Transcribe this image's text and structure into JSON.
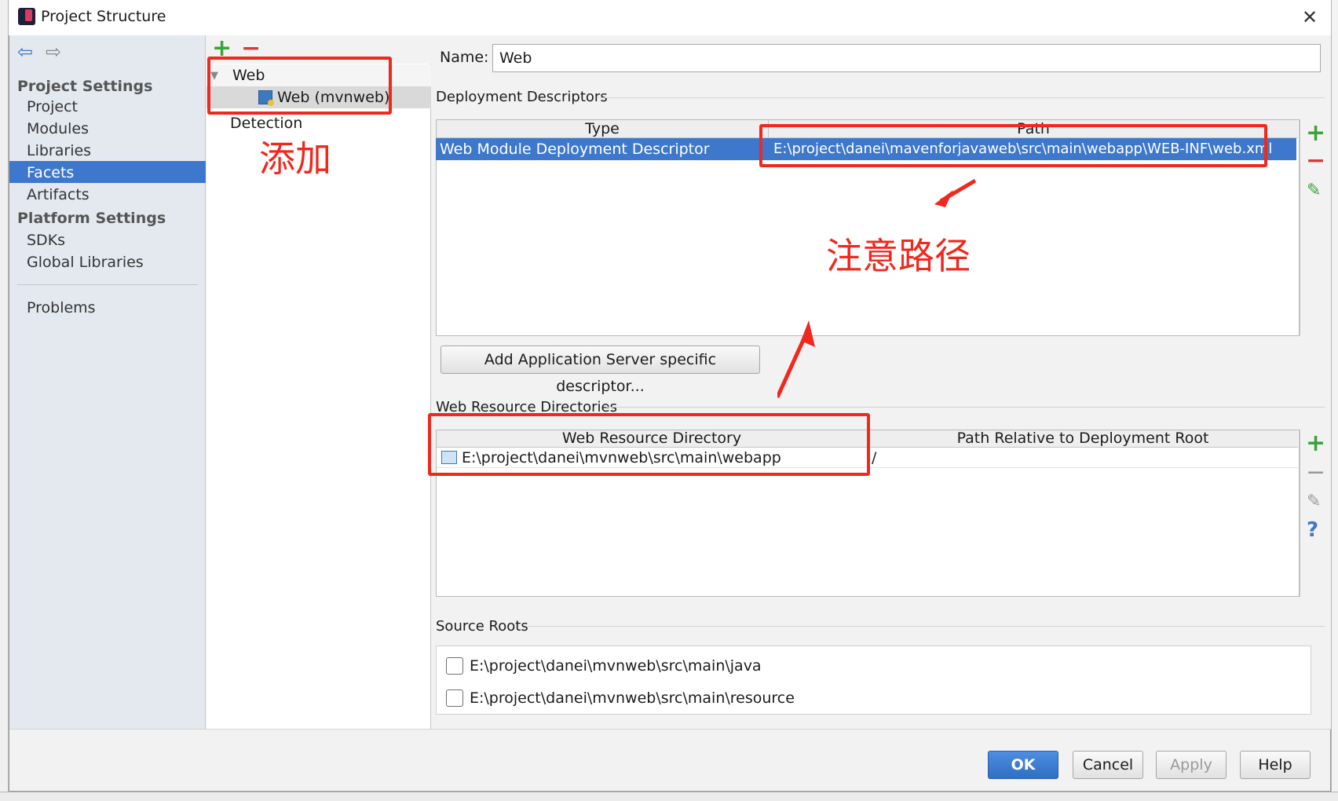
{
  "window": {
    "title": "Project Structure",
    "close_glyph": "✕"
  },
  "nav": {
    "back_glyph": "⇦",
    "forward_glyph": "⇨",
    "project_settings": "Project Settings",
    "items1": [
      "Project",
      "Modules",
      "Libraries",
      "Facets",
      "Artifacts"
    ],
    "platform_settings": "Platform Settings",
    "items2": [
      "SDKs",
      "Global Libraries"
    ],
    "problems": "Problems",
    "selected": "Facets"
  },
  "tree": {
    "add_glyph": "+",
    "remove_glyph": "−",
    "expand_glyph": "▼",
    "root": "Web",
    "child": "Web (mvnweb)",
    "detection": "Detection"
  },
  "name_field": {
    "label": "Name:",
    "value": "Web"
  },
  "deployment": {
    "title": "Deployment Descriptors",
    "col_type": "Type",
    "col_path": "Path",
    "row_type": "Web Module Deployment Descriptor",
    "row_path": "E:\\project\\danei\\mavenforjavaweb\\src\\main\\webapp\\WEB-INF\\web.xml",
    "add_server_button": "Add Application Server specific descriptor..."
  },
  "web_resources": {
    "title": "Web Resource Directories",
    "col_dir": "Web Resource Directory",
    "col_rel": "Path Relative to Deployment Root",
    "row_dir": "E:\\project\\danei\\mvnweb\\src\\main\\webapp",
    "row_rel": "/"
  },
  "source_roots": {
    "title": "Source Roots",
    "items": [
      "E:\\project\\danei\\mvnweb\\src\\main\\java",
      "E:\\project\\danei\\mvnweb\\src\\main\\resource"
    ]
  },
  "toolbar_glyphs": {
    "add": "+",
    "remove": "−",
    "edit": "✎",
    "help": "?"
  },
  "buttons": {
    "ok": "OK",
    "cancel": "Cancel",
    "apply": "Apply",
    "help": "Help"
  },
  "annotations": {
    "add": "添加",
    "note_path": "注意路径"
  },
  "colors": {
    "selection": "#3d78cc",
    "annotation_red": "#f0281e",
    "add_green": "#3aa33a"
  }
}
